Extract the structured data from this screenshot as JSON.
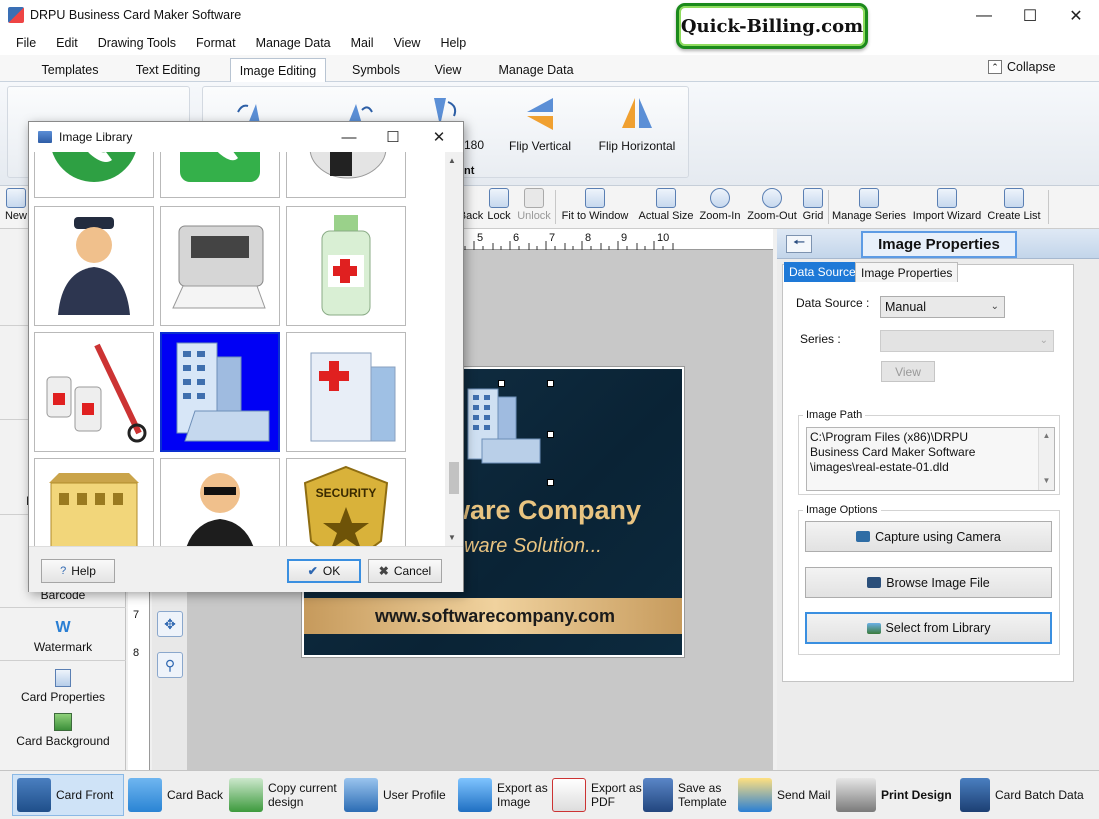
{
  "window": {
    "title": "DRPU Business Card Maker Software",
    "brand": "Quick-Billing.com"
  },
  "menu": [
    "File",
    "Edit",
    "Drawing Tools",
    "Format",
    "Manage Data",
    "Mail",
    "View",
    "Help"
  ],
  "ribbon_tabs": [
    "Templates",
    "Text Editing",
    "Image Editing",
    "Symbols",
    "View",
    "Manage Data"
  ],
  "active_ribbon_tab": "Image Editing",
  "collapse_label": "Collapse",
  "ribbon": {
    "rotate_label_fragment": "180",
    "flip_vertical": "Flip Vertical",
    "flip_horizontal": "Flip Horizontal",
    "group_label_fragment": "nt"
  },
  "toolbar": {
    "new": "New",
    "back": "Back",
    "lock": "Lock",
    "unlock": "Unlock",
    "fit_to_window": "Fit to Window",
    "actual_size": "Actual Size",
    "zoom_in": "Zoom-In",
    "zoom_out": "Zoom-Out",
    "grid": "Grid",
    "manage_series": "Manage Series",
    "import_wizard": "Import Wizard",
    "create_list": "Create List"
  },
  "left_panel": {
    "barcode": "Barcode",
    "watermark": "Watermark",
    "card_properties": "Card Properties",
    "card_background": "Card Background",
    "fragment": "I"
  },
  "ruler": {
    "h_ticks": [
      "5",
      "6",
      "7",
      "8",
      "9",
      "10"
    ],
    "v_ticks": [
      "7",
      "8"
    ]
  },
  "card": {
    "company": "ware Company",
    "tagline": "ware Solution...",
    "website": "www.softwarecompany.com"
  },
  "image_properties": {
    "title": "Image Properties",
    "tabs": [
      "Data Source",
      "Image Properties"
    ],
    "data_source_label": "Data Source :",
    "data_source_value": "Manual",
    "series_label": "Series :",
    "series_value": "",
    "view_button": "View",
    "image_path_label": "Image Path",
    "image_path_lines": [
      "C:\\Program Files (x86)\\DRPU",
      "Business Card Maker Software",
      "\\images\\real-estate-01.dld"
    ],
    "image_options_label": "Image Options",
    "capture_camera": "Capture using Camera",
    "browse_image": "Browse Image File",
    "select_library": "Select from Library"
  },
  "dialog": {
    "title": "Image Library",
    "help": "Help",
    "ok": "OK",
    "cancel": "Cancel",
    "images": [
      "phone-green-round-image",
      "phone-green-square-image",
      "helmet-image",
      "police-officer-image",
      "printer-image",
      "medicine-bottle-image",
      "syringe-vials-image",
      "office-building-image",
      "hospital-building-image",
      "school-building-image",
      "security-guard-image",
      "security-badge-image"
    ],
    "selected_image": "office-building-image",
    "badge_text": "SECURITY"
  },
  "bottom_bar": {
    "card_front": "Card Front",
    "card_back": "Card Back",
    "copy_current_design": [
      "Copy current",
      "design"
    ],
    "user_profile": "User Profile",
    "export_image": [
      "Export as",
      "Image"
    ],
    "export_pdf": [
      "Export as",
      "PDF"
    ],
    "save_template": [
      "Save as",
      "Template"
    ],
    "send_mail": "Send Mail",
    "print_design": "Print Design",
    "card_batch_data": "Card Batch Data"
  },
  "colors": {
    "accent": "#1e79d7",
    "card_gold": "#e9c481",
    "card_dark": "#0a2335",
    "brand_green": "#1b8a1b",
    "selection_blue": "#0000f5"
  }
}
